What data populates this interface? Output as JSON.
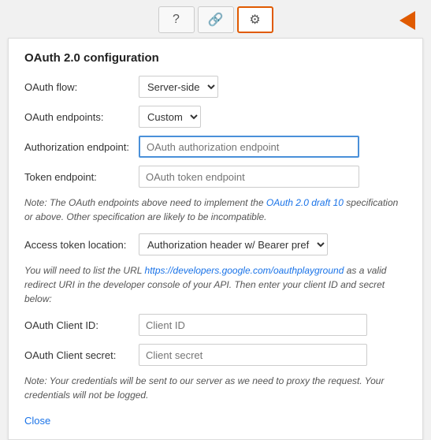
{
  "toolbar": {
    "help_icon": "?",
    "link_icon": "🔗",
    "settings_icon": "⚙"
  },
  "panel": {
    "title": "OAuth 2.0 configuration",
    "flow_label": "OAuth flow:",
    "flow_value": "Server-side",
    "endpoints_label": "OAuth endpoints:",
    "endpoints_value": "Custom",
    "auth_endpoint_label": "Authorization endpoint:",
    "auth_endpoint_placeholder": "OAuth authorization endpoint",
    "token_endpoint_label": "Token endpoint:",
    "token_endpoint_placeholder": "OAuth token endpoint",
    "note1": "Note: The OAuth endpoints above need to implement the OAuth 2.0 draft 10 specification or above. Other specification are likely to be incompatible.",
    "note1_link_text": "OAuth 2.0 draft 10",
    "access_location_label": "Access token location:",
    "access_location_value": "Authorization header w/ Bearer prefix",
    "note2_pre": "You will need to list the URL ",
    "note2_url": "https://developers.google.com/oauthplayground",
    "note2_post": " as a valid redirect URI in the developer console of your API. Then enter your client ID and secret below:",
    "client_id_label": "OAuth Client ID:",
    "client_id_placeholder": "Client ID",
    "client_secret_label": "OAuth Client secret:",
    "client_secret_placeholder": "Client secret",
    "note3": "Note: Your credentials will be sent to our server as we need to proxy the request. Your credentials will not be logged.",
    "close_label": "Close"
  }
}
